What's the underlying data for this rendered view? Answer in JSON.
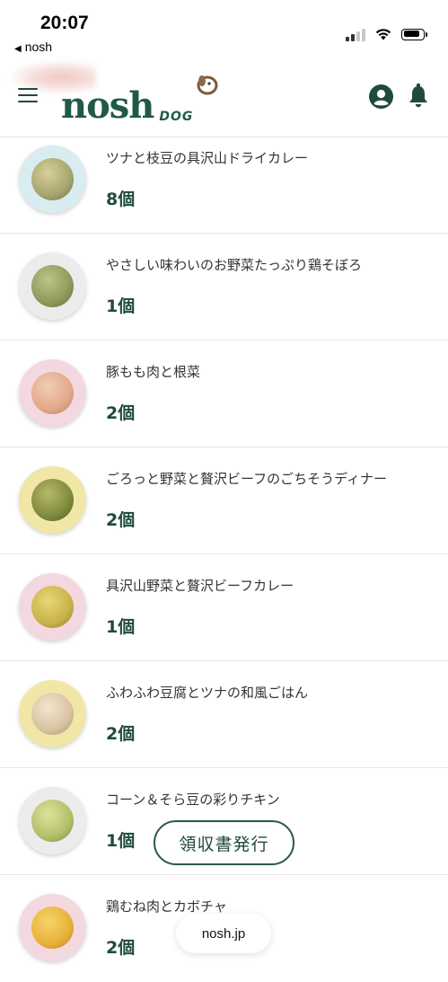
{
  "status_bar": {
    "time": "20:07",
    "back_label": "nosh"
  },
  "header": {
    "logo_text": "nosh",
    "logo_sub": "DOG"
  },
  "items": [
    {
      "name": "ツナと枝豆の具沢山ドライカレー",
      "qty": "8個",
      "bowl_color": "#d9ecef",
      "food_color": "#a7a56f"
    },
    {
      "name": "やさしい味わいのお野菜たっぷり鶏そぼろ",
      "qty": "1個",
      "bowl_color": "#ececec",
      "food_color": "#8e9a5b"
    },
    {
      "name": "豚もも肉と根菜",
      "qty": "2個",
      "bowl_color": "#f3d9df",
      "food_color": "#e3a88a"
    },
    {
      "name": "ごろっと野菜と贅沢ビーフのごちそうディナー",
      "qty": "2個",
      "bowl_color": "#f0e7a6",
      "food_color": "#7f8a3c"
    },
    {
      "name": "具沢山野菜と贅沢ビーフカレー",
      "qty": "1個",
      "bowl_color": "#f3d9df",
      "food_color": "#c9b34a"
    },
    {
      "name": "ふわふわ豆腐とツナの和風ごはん",
      "qty": "2個",
      "bowl_color": "#f0e7a6",
      "food_color": "#d8c3a2"
    },
    {
      "name": "コーン＆そら豆の彩りチキン",
      "qty": "1個",
      "bowl_color": "#ececec",
      "food_color": "#b4be6a"
    },
    {
      "name": "鶏むね肉とカボチャ",
      "qty": "2個",
      "bowl_color": "#f3d9df",
      "food_color": "#e8b13a"
    }
  ],
  "receipt_button": "領収書発行",
  "browser_domain": "nosh.jp",
  "accent_color": "#1f4a3c"
}
